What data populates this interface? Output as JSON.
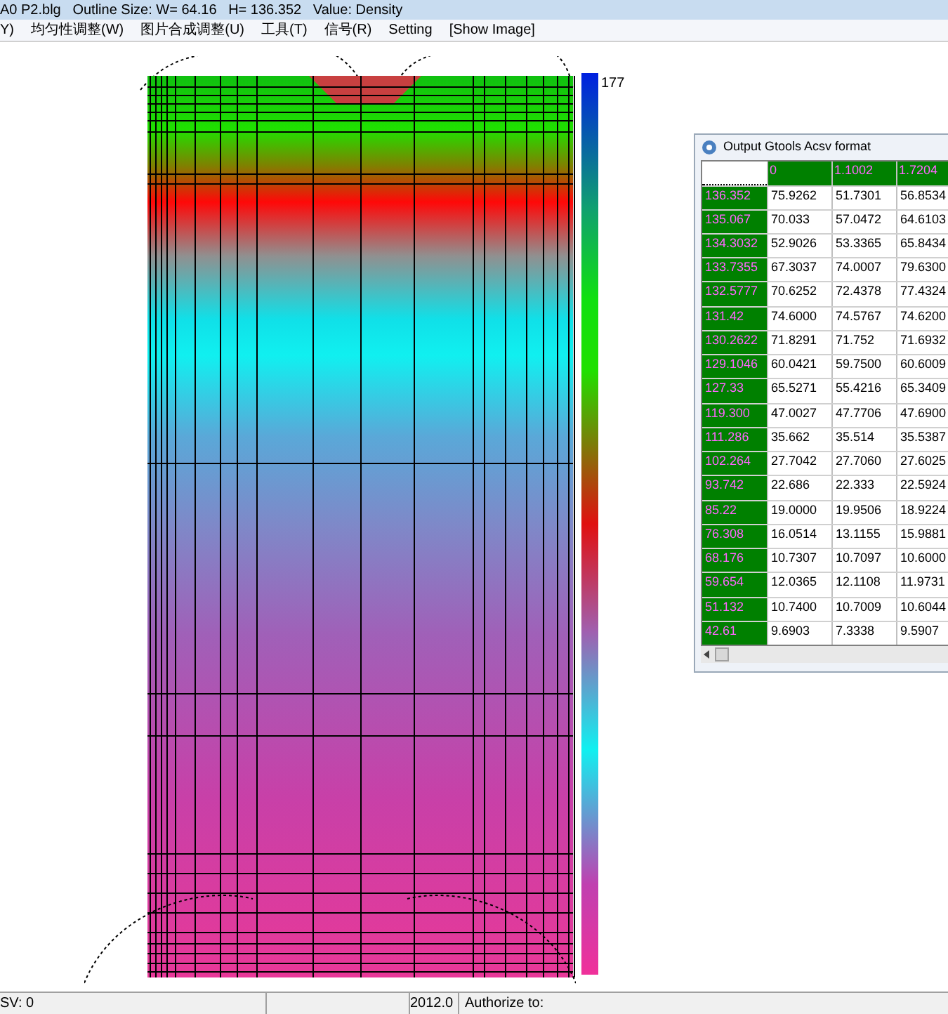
{
  "window": {
    "title": "A0 P2.blg   Outline Size: W= 64.16   H= 136.352   Value: Density"
  },
  "menu": [
    "Y)",
    "均匀性调整(W)",
    "图片合成调整(U)",
    "工具(T)",
    "信号(R)",
    "Setting",
    "[Show Image]"
  ],
  "colorbar": {
    "label": "177"
  },
  "csv_window": {
    "title": "Output Gtools Acsv format",
    "header": [
      "0",
      "1.1002",
      "1.7204"
    ],
    "rows": [
      [
        "136.352",
        "75.9262",
        "51.7301",
        "56.8534"
      ],
      [
        "135.067",
        "70.033",
        "57.0472",
        "64.6103"
      ],
      [
        "134.3032",
        "52.9026",
        "53.3365",
        "65.8434"
      ],
      [
        "133.7355",
        "67.3037",
        "74.0007",
        "79.6300"
      ],
      [
        "132.5777",
        "70.6252",
        "72.4378",
        "77.4324"
      ],
      [
        "131.42",
        "74.6000",
        "74.5767",
        "74.6200"
      ],
      [
        "130.2622",
        "71.8291",
        "71.752",
        "71.6932"
      ],
      [
        "129.1046",
        "60.0421",
        "59.7500",
        "60.6009"
      ],
      [
        "127.33",
        "65.5271",
        "55.4216",
        "65.3409"
      ],
      [
        "119.300",
        "47.0027",
        "47.7706",
        "47.6900"
      ],
      [
        "111.286",
        "35.662",
        "35.514",
        "35.5387"
      ],
      [
        "102.264",
        "27.7042",
        "27.7060",
        "27.6025"
      ],
      [
        "93.742",
        "22.686",
        "22.333",
        "22.5924"
      ],
      [
        "85.22",
        "19.0000",
        "19.9506",
        "18.9224"
      ],
      [
        "76.308",
        "16.0514",
        "13.1155",
        "15.9881"
      ],
      [
        "68.176",
        "10.7307",
        "10.7097",
        "10.6000"
      ],
      [
        "59.654",
        "12.0365",
        "12.1108",
        "11.9731"
      ],
      [
        "51.132",
        "10.7400",
        "10.7009",
        "10.6044"
      ],
      [
        "42.61",
        "9.6903",
        "7.3338",
        "9.5907"
      ]
    ]
  },
  "status_bar": [
    "SV: 0",
    "2012.0",
    "Authorize to:"
  ]
}
